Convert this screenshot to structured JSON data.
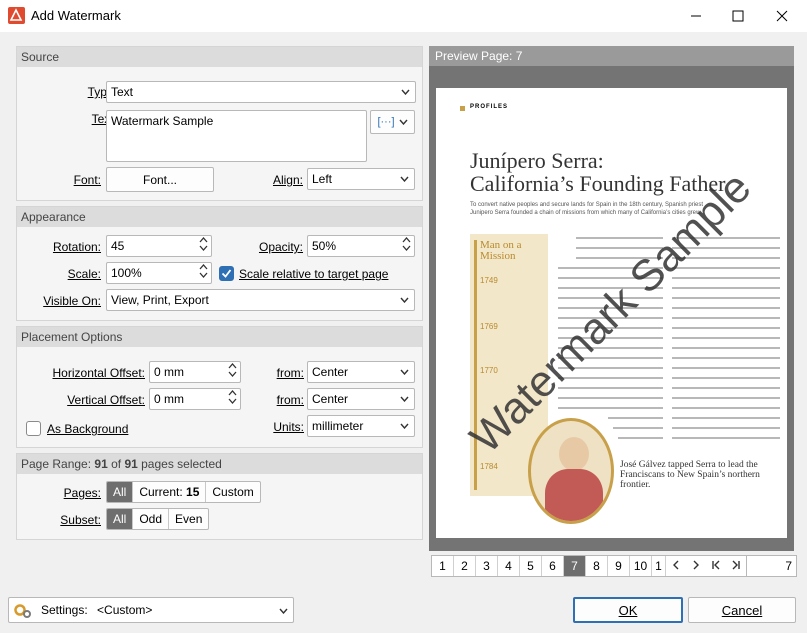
{
  "window": {
    "title": "Add Watermark"
  },
  "source": {
    "header": "Source",
    "type_label": "Type:",
    "type_value": "Text",
    "text_label": "Text:",
    "text_value": "Watermark Sample",
    "macro_button": "[···]",
    "font_label": "Font:",
    "font_button": "Font...",
    "align_label": "Align:",
    "align_value": "Left"
  },
  "appearance": {
    "header": "Appearance",
    "rotation_label": "Rotation:",
    "rotation_value": "45",
    "opacity_label": "Opacity:",
    "opacity_value": "50%",
    "scale_label": "Scale:",
    "scale_value": "100%",
    "scale_relative_label": "Scale relative to target page",
    "scale_relative_checked": true,
    "visible_on_label": "Visible On:",
    "visible_on_value": "View, Print, Export"
  },
  "placement": {
    "header": "Placement Options",
    "h_offset_label": "Horizontal Offset:",
    "h_offset_value": "0 mm",
    "h_from_label": "from:",
    "h_from_value": "Center",
    "v_offset_label": "Vertical Offset:",
    "v_offset_value": "0 mm",
    "v_from_label": "from:",
    "v_from_value": "Center",
    "as_background_label": "As Background",
    "as_background_checked": false,
    "units_label": "Units:",
    "units_value": "millimeter"
  },
  "page_range": {
    "text_prefix": "Page Range: ",
    "selected": "91",
    "text_mid": " of ",
    "total": "91",
    "text_suffix": " pages selected",
    "pages_label": "Pages:",
    "pages_options": {
      "all": "All",
      "current_prefix": "Current: ",
      "current_value": "15",
      "custom": "Custom"
    },
    "subset_label": "Subset:",
    "subset_options": {
      "all": "All",
      "odd": "Odd",
      "even": "Even"
    }
  },
  "preview": {
    "header": "Preview Page: 7",
    "article": {
      "kicker": "PROFILES",
      "headline_1": "Junípero Serra:",
      "headline_2": "California’s Founding Father",
      "deck_1": "To convert native peoples and secure lands for Spain in the 18th century, Spanish priest",
      "deck_2": "Junipero Serra founded a chain of missions from which many of California’s cities grew.",
      "sidebar_title": "Man on a Mission",
      "years": [
        "1749",
        "1769",
        "1770",
        "1784"
      ],
      "caption": "José Gálvez tapped Serra to lead the Franciscans to New Spain’s northern frontier."
    },
    "watermark_text": "Watermark Sample"
  },
  "pager": {
    "pages": [
      "1",
      "2",
      "3",
      "4",
      "5",
      "6",
      "7",
      "8",
      "9",
      "10",
      "1"
    ],
    "current_input": "7"
  },
  "footer": {
    "settings_label": "Settings:",
    "settings_value": "<Custom>",
    "ok": "OK",
    "cancel": "Cancel"
  },
  "colors": {
    "accent": "#2f6fb3",
    "watermark": "#333333",
    "sidebar": "#f3e7c9",
    "gold": "#c8a04a"
  }
}
